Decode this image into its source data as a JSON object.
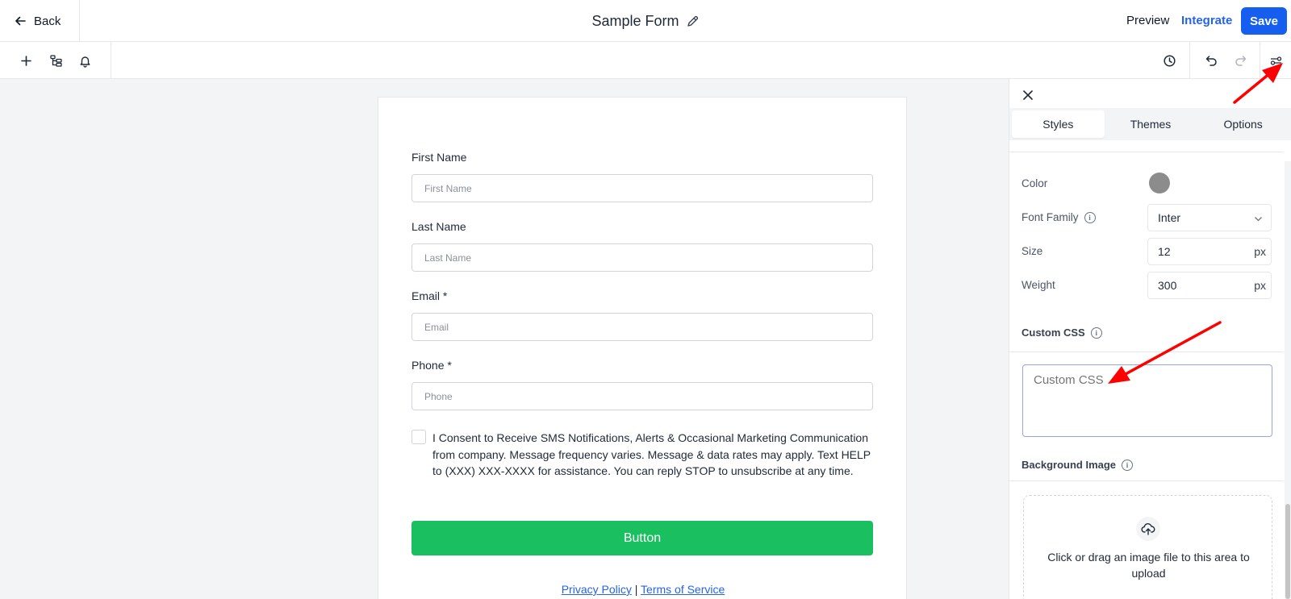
{
  "header": {
    "back_label": "Back",
    "form_title": "Sample Form",
    "preview_label": "Preview",
    "integrate_label": "Integrate",
    "save_label": "Save"
  },
  "toolbar": {
    "left_icons": [
      "plus-icon",
      "layout-icon",
      "bell-icon"
    ],
    "right_icons": [
      "history-icon",
      "undo-icon",
      "redo-icon",
      "settings-sliders-icon"
    ]
  },
  "form": {
    "fields": [
      {
        "label": "First Name",
        "placeholder": "First Name"
      },
      {
        "label": "Last Name",
        "placeholder": "Last Name"
      },
      {
        "label": "Email *",
        "placeholder": "Email"
      },
      {
        "label": "Phone *",
        "placeholder": "Phone"
      }
    ],
    "consent_text": "I Consent to Receive SMS Notifications, Alerts & Occasional Marketing Communication from company. Message frequency varies. Message & data rates may apply. Text HELP to (XXX) XXX-XXXX for assistance. You can reply STOP to unsubscribe at any time.",
    "button_label": "Button",
    "privacy_label": "Privacy Policy",
    "separator": "|",
    "terms_label": "Terms of Service"
  },
  "panel": {
    "tabs": [
      "Styles",
      "Themes",
      "Options"
    ],
    "active_tab": "Styles",
    "color_label": "Color",
    "color_value": "#8c8c8c",
    "font_family_label": "Font Family",
    "font_family_value": "Inter",
    "size_label": "Size",
    "size_value": "12",
    "weight_label": "Weight",
    "weight_value": "300",
    "unit": "px",
    "custom_css_label": "Custom CSS",
    "custom_css_placeholder": "Custom CSS",
    "background_image_label": "Background Image",
    "upload_text": "Click or drag an image file to this area to upload"
  },
  "colors": {
    "save_button": "#155eef",
    "integrate_link": "#2563eb",
    "form_button": "#1ac060",
    "annotation_arrow": "#ff0000"
  }
}
